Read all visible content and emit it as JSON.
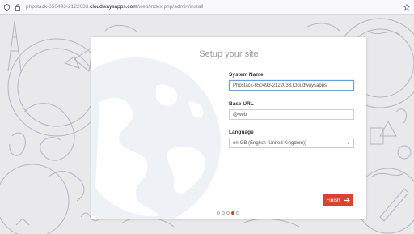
{
  "browser": {
    "url_prefix": "phpstack-650493-2122033.",
    "url_host": "cloudwaysapps.com",
    "url_path": "/web/index.php/admin/install"
  },
  "installer": {
    "title": "Setup your site",
    "system_name_label": "System Name",
    "system_name_value": "Phpstack-650493-2122033.Cloudwaysapps",
    "base_url_label": "Base URL",
    "base_url_value": "@web",
    "language_label": "Language",
    "language_value": "en-GB (English (United Kingdom))",
    "finish_label": "Finish",
    "steps_total": 5,
    "current_step": 4
  },
  "colors": {
    "accent": "#d9432f",
    "focus_border": "#6aa0d8"
  }
}
